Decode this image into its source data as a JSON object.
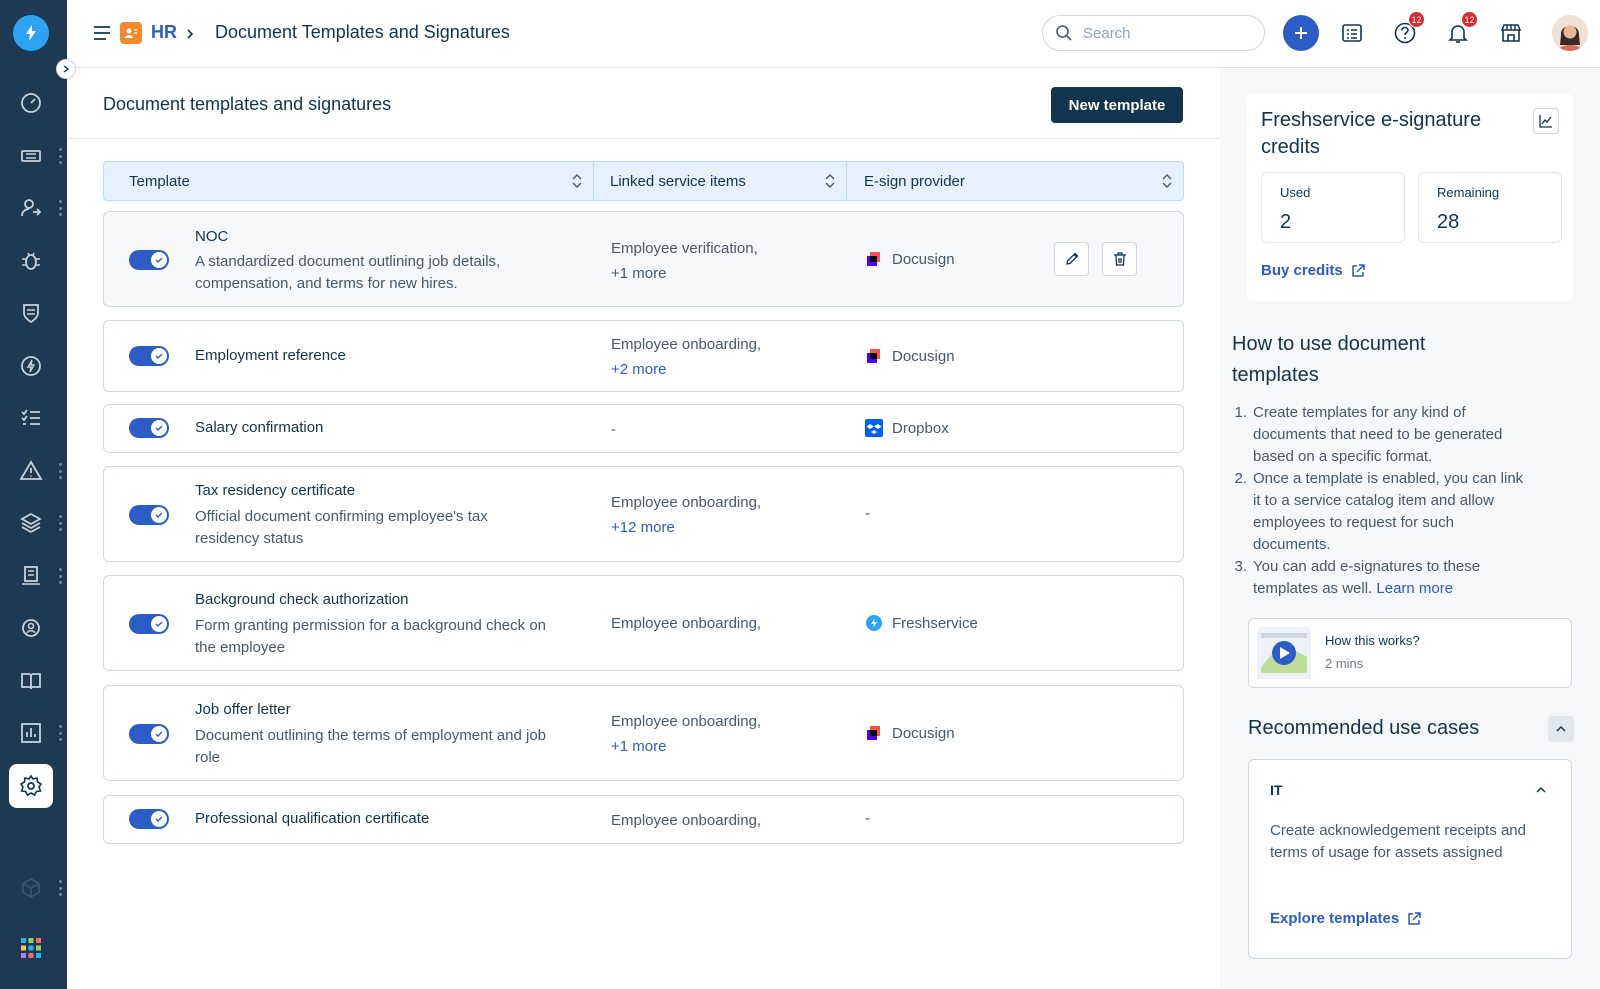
{
  "topbar": {
    "module": "HR",
    "title": "Document Templates and Signatures",
    "search_placeholder": "Search",
    "help_badge": "12",
    "notif_badge": "12"
  },
  "page": {
    "title": "Document templates and signatures",
    "new_button": "New template"
  },
  "table": {
    "columns": [
      "Template",
      "Linked service items",
      "E-sign provider"
    ],
    "rows": [
      {
        "name": "NOC",
        "description": "A standardized document outlining job details, compensation, and terms for new hires.",
        "linked": "Employee verification,",
        "more": "+1 more",
        "provider": "Docusign",
        "provider_icon": "docusign-icon",
        "enabled": true
      },
      {
        "name": "Employment reference",
        "description": "",
        "linked": "Employee onboarding,",
        "more": "+2 more",
        "provider": "Docusign",
        "provider_icon": "docusign-icon",
        "enabled": true
      },
      {
        "name": "Salary confirmation",
        "description": "",
        "linked": "-",
        "more": "",
        "provider": "Dropbox",
        "provider_icon": "dropbox-icon",
        "enabled": true
      },
      {
        "name": "Tax residency certificate",
        "description": "Official document confirming employee's tax residency status",
        "linked": "Employee onboarding,",
        "more": "+12 more",
        "provider": "-",
        "provider_icon": "",
        "enabled": true
      },
      {
        "name": "Background check authorization",
        "description": "Form granting permission for a background check on the employee",
        "linked": "Employee onboarding,",
        "more": "",
        "provider": "Freshservice",
        "provider_icon": "freshservice-icon",
        "enabled": true
      },
      {
        "name": "Job offer letter",
        "description": "Document outlining the terms of employment and job role",
        "linked": "Employee onboarding,",
        "more": "+1 more",
        "provider": "Docusign",
        "provider_icon": "docusign-icon",
        "enabled": true
      },
      {
        "name": "Professional qualification certificate",
        "description": "",
        "linked": "Employee onboarding,",
        "more": "",
        "provider": "-",
        "provider_icon": "",
        "enabled": true
      }
    ]
  },
  "credits": {
    "title": "Freshservice e-signature credits",
    "used_label": "Used",
    "used_value": "2",
    "remaining_label": "Remaining",
    "remaining_value": "28",
    "buy_label": "Buy credits"
  },
  "howto": {
    "title": "How to use document templates",
    "steps": [
      "Create templates for any kind of documents that need to be generated based on a specific format.",
      "Once a template is enabled, you can link it to a service catalog item and allow employees to request for such documents.",
      "You can add e-signatures to these templates as well."
    ],
    "learn_more": "Learn more",
    "video_title": "How this works?",
    "video_duration": "2 mins"
  },
  "recommended": {
    "title": "Recommended use cases",
    "card_title": "IT",
    "card_desc": "Create acknowledgement receipts and terms of usage for assets assigned",
    "card_link": "Explore templates"
  },
  "colors": {
    "sidebar": "#1d3a52",
    "primary": "#2c5cc5",
    "dark_button": "#12344d",
    "header_bg": "#e5f2fd"
  }
}
